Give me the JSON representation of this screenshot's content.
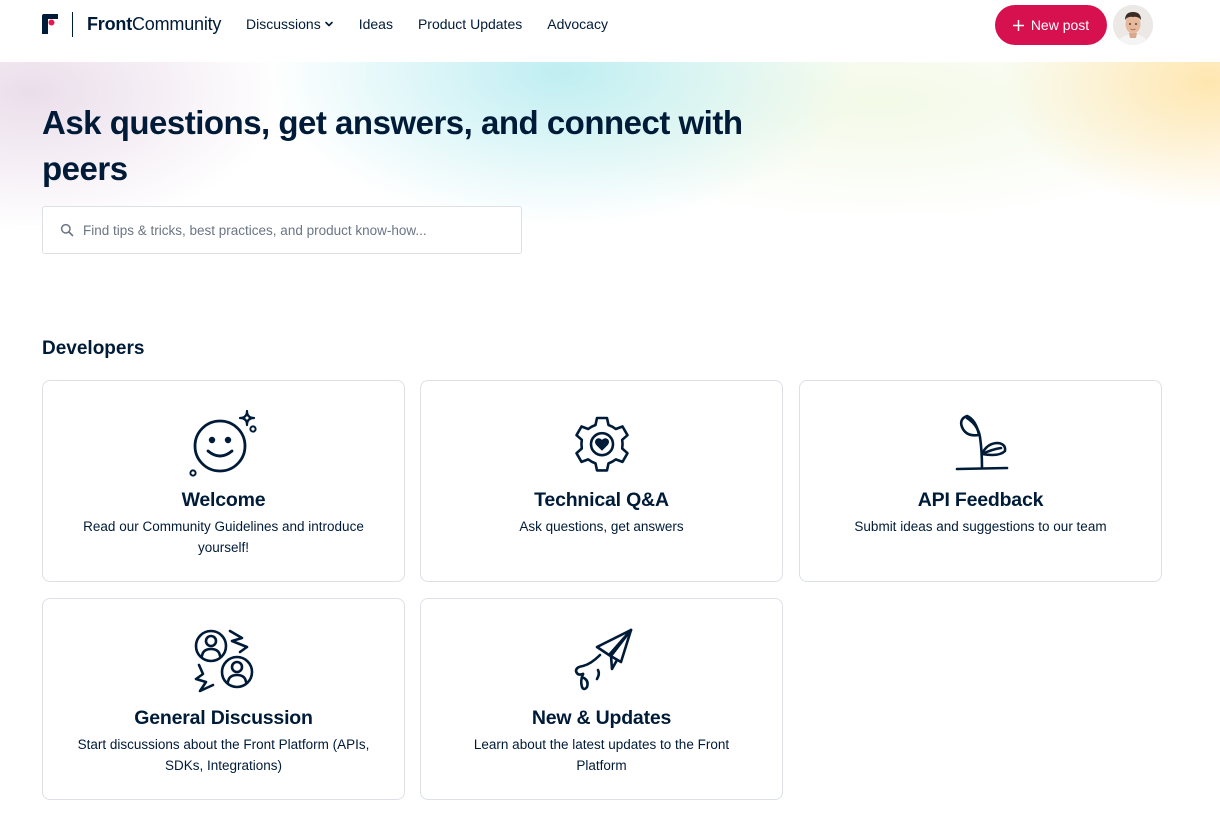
{
  "header": {
    "brand": {
      "bold": "Front",
      "rest": "Community"
    },
    "nav": [
      {
        "label": "Discussions",
        "has_dropdown": true
      },
      {
        "label": "Ideas"
      },
      {
        "label": "Product Updates"
      },
      {
        "label": "Advocacy"
      }
    ],
    "new_post_label": "New post",
    "accent_color": "#d7104f"
  },
  "hero": {
    "title": "Ask questions, get answers, and connect with peers",
    "search_placeholder": "Find tips & tricks, best practices, and product know-how..."
  },
  "section": {
    "title": "Developers",
    "cards": [
      {
        "icon": "smiley-icon",
        "title": "Welcome",
        "description": "Read our Community Guidelines and introduce yourself!"
      },
      {
        "icon": "gear-heart-icon",
        "title": "Technical Q&A",
        "description": "Ask questions, get answers"
      },
      {
        "icon": "sprout-icon",
        "title": "API Feedback",
        "description": "Submit ideas and suggestions to our team"
      },
      {
        "icon": "people-discussion-icon",
        "title": "General Discussion",
        "description": "Start discussions about the Front Platform (APIs, SDKs, Integrations)"
      },
      {
        "icon": "paper-plane-icon",
        "title": "New & Updates",
        "description": "Learn about the latest updates to the Front Platform"
      }
    ]
  }
}
